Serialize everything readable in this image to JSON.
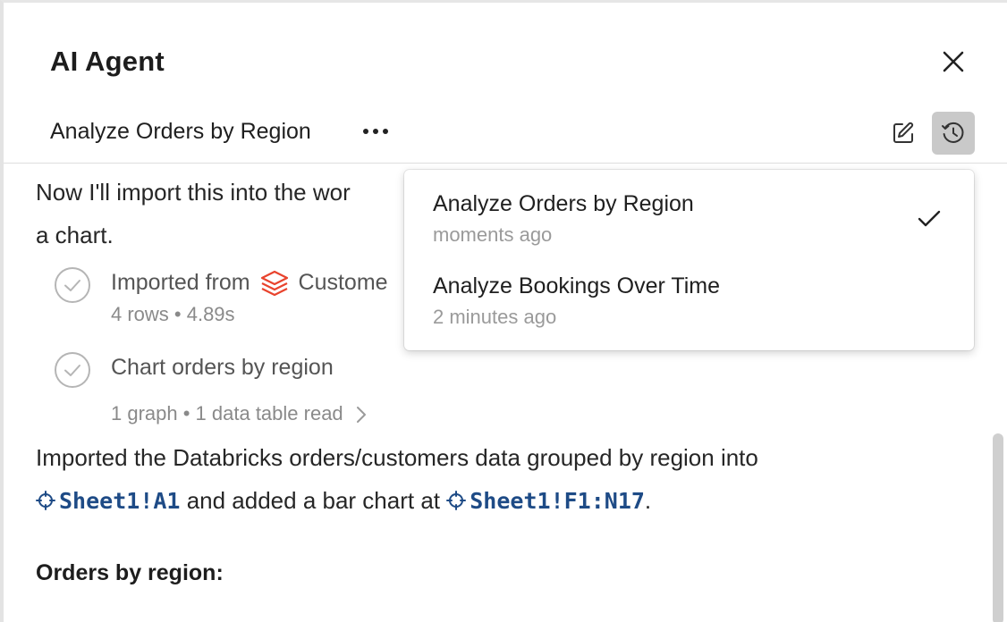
{
  "header": {
    "title": "AI Agent"
  },
  "conversation": {
    "title": "Analyze Orders by Region",
    "more_label": "•••"
  },
  "chat": {
    "intro_line1": "Now I'll import this into the wor",
    "intro_line2": "a chart.",
    "steps": [
      {
        "label_prefix": "Imported from",
        "label_source": "Custome",
        "meta": "4 rows • 4.89s"
      },
      {
        "label": "Chart orders by region",
        "meta": "1 graph • 1 data table read"
      }
    ],
    "summary_part1": "Imported the Databricks orders/customers data grouped by region into",
    "ref1": "Sheet1!A1",
    "summary_part2": " and added a bar chart at ",
    "ref2": "Sheet1!F1:N17",
    "summary_end": ".",
    "section_heading": "Orders by region:"
  },
  "history_menu": {
    "items": [
      {
        "name": "Analyze Orders by Region",
        "time": "moments ago",
        "selected": true
      },
      {
        "name": "Analyze Bookings Over Time",
        "time": "2 minutes ago",
        "selected": false
      }
    ]
  },
  "colors": {
    "ref_link": "#1e4b86",
    "databricks_icon": "#e8432d",
    "history_button_bg": "#c9c9c9"
  },
  "icons": {
    "close": "close-icon",
    "more": "more-horizontal-icon",
    "edit": "edit-icon",
    "history": "history-icon",
    "step_check": "check-circle-icon",
    "databricks": "databricks-icon",
    "chevron": "chevron-right-icon",
    "ref": "crosshair-icon",
    "menu_check": "checkmark-icon"
  }
}
